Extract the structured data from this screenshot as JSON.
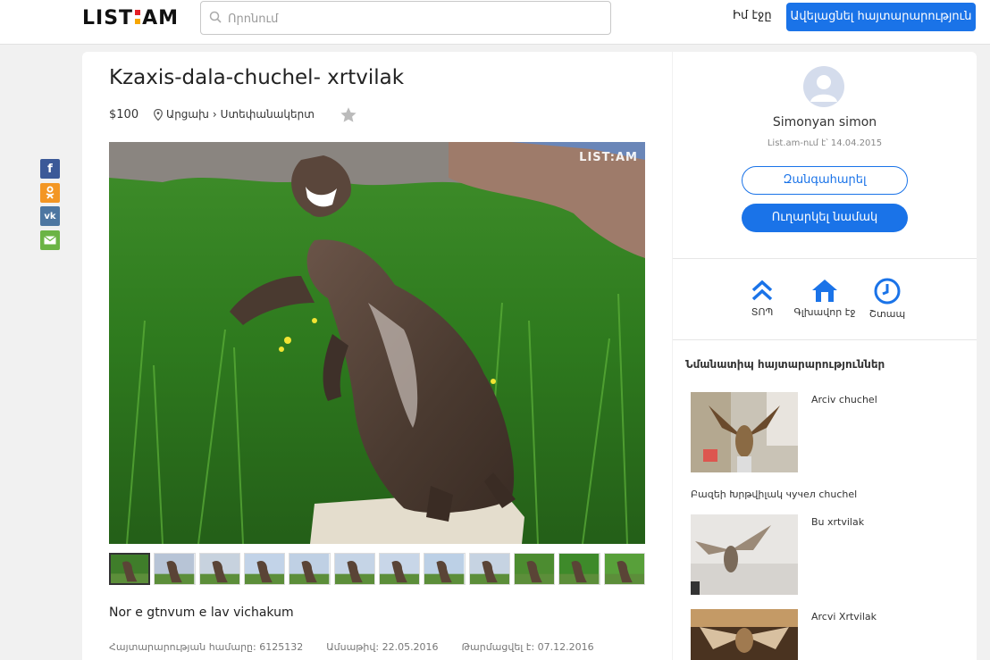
{
  "header": {
    "logo": {
      "part1": "LIST",
      "part2": "AM"
    },
    "search_placeholder": "Որոնում",
    "my_page": "Իմ էջը",
    "post_button": "Ավելացնել հայտարարություն"
  },
  "listing": {
    "title": "Kzaxis-dala-chuchel- xrtvilak",
    "price": "$100",
    "region": "Արցախ",
    "separator": "›",
    "city": "Ստեփանակերտ",
    "watermark": "LIST:AM",
    "thumb_count": 12,
    "selected_thumb": 1,
    "description": "Nor e gtnvum e lav vichakum",
    "meta": {
      "ad_number": "Հայտարարության համարը: 6125132",
      "date": "Ամսաթիվ: 22.05.2016",
      "updated": "Թարմացվել է: 07.12.2016"
    }
  },
  "share": {
    "icons": [
      "facebook-icon",
      "odnoklassniki-icon",
      "vk-icon",
      "email-icon"
    ],
    "colors": {
      "facebook": "#3b5998",
      "odnoklassniki": "#f39624",
      "vk": "#4d76a1",
      "email": "#6bb445"
    }
  },
  "seller": {
    "name": "Simonyan simon",
    "since": "List.am-ում է՝ 14.04.2015",
    "call_button": "Զանգահարել",
    "message_button": "Ուղարկել նամակ"
  },
  "actions": {
    "top": "ՏՈՊ",
    "home": "Գլխավոր էջ",
    "soon": "Շտապ"
  },
  "similar": {
    "title": "Նմանատիպ հայտարարություններ",
    "items": [
      {
        "label": "Arciv chuchel"
      },
      {
        "label": "Բազեի Խրթվիլակ чучел chuchel"
      },
      {
        "label": "Bu xrtvilak"
      },
      {
        "label": "Arcvi Xrtvilak"
      }
    ]
  },
  "colors": {
    "accent": "#1a73e8",
    "background": "#f1f1f1"
  }
}
